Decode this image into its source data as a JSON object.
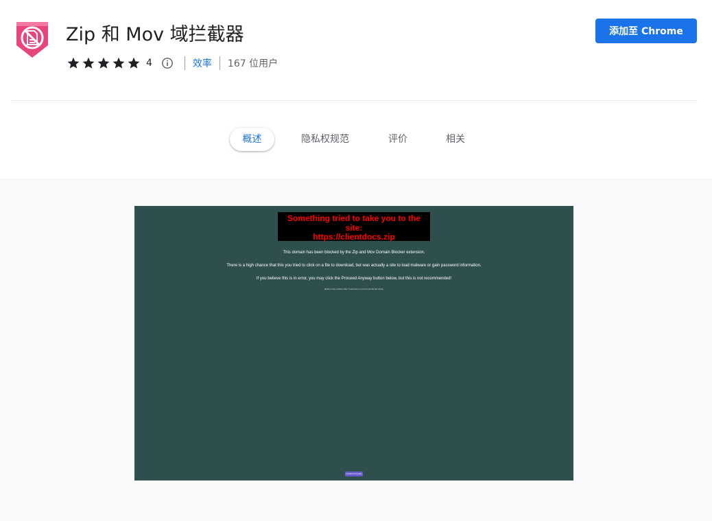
{
  "extension": {
    "title": "Zip 和 Mov 域拦截器",
    "icon": "no-file-shield-icon",
    "rating": "4",
    "category": "效率",
    "users": "167 位用户",
    "add_button_label": "添加至 Chrome"
  },
  "tabs": [
    {
      "label": "概述",
      "active": true
    },
    {
      "label": "隐私权规范",
      "active": false
    },
    {
      "label": "评价",
      "active": false
    },
    {
      "label": "相关",
      "active": false
    }
  ],
  "screenshot": {
    "heading_line1": "Something tried to take you to the site:",
    "heading_line2": "https://clientdocs.zip",
    "line1": "This domain has been blocked by the Zip and Mov Domain Blocker extension.",
    "line2": "There is a high chance that this you tried to click on a file to download, but was actually a site to load malware or gain password information.",
    "line3": "If you believe this is in error, you may click the Proceed Anyway button below, but this is not recommended!",
    "note": "(Button only enables after 5 seconds to prevent accidental clicks)",
    "button_label": "Continue Anyway"
  },
  "colors": {
    "accent": "#1a73e8",
    "icon_pink": "#e8457a",
    "screenshot_bg": "#2f4f4f",
    "warning_red": "#ff0000",
    "button_purple": "#6a5acd"
  }
}
